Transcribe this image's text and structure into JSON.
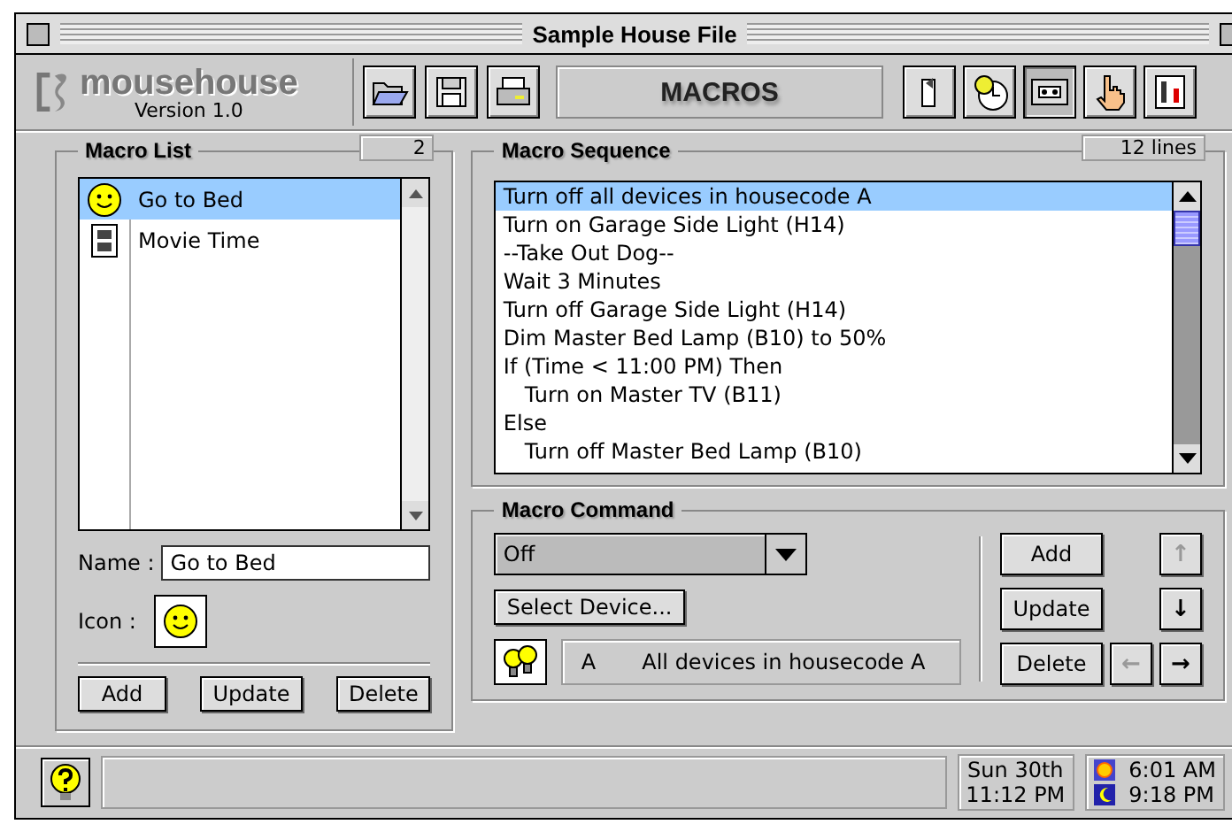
{
  "window": {
    "title": "Sample House File"
  },
  "toolbar": {
    "logo": "mousehouse",
    "version": "Version 1.0",
    "section": "MACROS",
    "mode_buttons": [
      {
        "kind": "switch",
        "selected": false
      },
      {
        "kind": "timer",
        "selected": false
      },
      {
        "kind": "macro",
        "selected": true
      },
      {
        "kind": "hand",
        "selected": false
      },
      {
        "kind": "settings",
        "selected": false
      }
    ]
  },
  "macro_list": {
    "title": "Macro List",
    "count": "2",
    "items": [
      {
        "name": "Go to Bed",
        "kind": "smiley",
        "selected": true
      },
      {
        "name": "Movie Time",
        "kind": "film",
        "selected": false
      }
    ],
    "name_label": "Name :",
    "name_value": "Go to Bed",
    "icon_label": "Icon :",
    "icon_well": {
      "kind": "smiley"
    },
    "buttons": [
      "Add",
      "Update",
      "Delete"
    ]
  },
  "macro_sequence": {
    "title": "Macro Sequence",
    "count": "12 lines",
    "lines": [
      {
        "text": "Turn off all devices in housecode A",
        "selected": true
      },
      {
        "text": "Turn on Garage Side Light (H14)",
        "selected": false
      },
      {
        "text": "--Take Out Dog--",
        "selected": false
      },
      {
        "text": "Wait 3 Minutes",
        "selected": false
      },
      {
        "text": "Turn off Garage Side Light (H14)",
        "selected": false
      },
      {
        "text": "Dim Master Bed Lamp (B10) to 50%",
        "selected": false
      },
      {
        "text": "If (Time < 11:00 PM) Then",
        "selected": false,
        "children": [
          {
            "text": "Turn on Master TV (B11)",
            "selected": false
          }
        ]
      },
      {
        "text": "Else",
        "selected": false,
        "children": [
          {
            "text": "Turn off Master Bed Lamp (B10)",
            "selected": false
          }
        ]
      }
    ]
  },
  "macro_command": {
    "title": "Macro Command",
    "command": "Off",
    "select_button": "Select Device...",
    "device_code": "A",
    "device_description": "All devices in housecode A",
    "buttons": [
      "Add",
      "Update",
      "Delete"
    ],
    "arrows": [
      {
        "symbol": "↑",
        "disabled": true
      },
      {
        "symbol": "↓",
        "disabled": false
      },
      {
        "symbol": "←",
        "disabled": true
      },
      {
        "symbol": "→",
        "disabled": false
      }
    ]
  },
  "status_bar": {
    "date": "Sun 30th",
    "time": "11:12 PM",
    "sunrise": "6:01 AM",
    "sunset": "9:18 PM"
  }
}
